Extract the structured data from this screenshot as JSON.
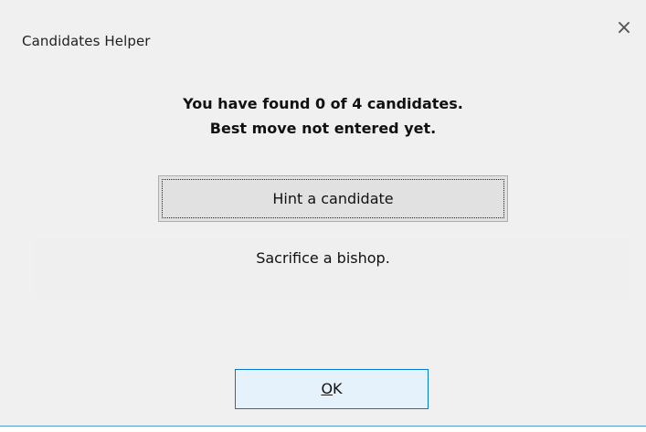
{
  "dialog": {
    "title": "Candidates Helper",
    "close_glyph": "×",
    "close_icon": "close-icon"
  },
  "status": {
    "found_line": "You have found 0 of 4 candidates.",
    "best_move_line": "Best move not entered yet."
  },
  "hint": {
    "button_label": "Hint a candidate",
    "text": "Sacrifice a bishop."
  },
  "ok": {
    "mnemonic": "O",
    "rest": "K"
  },
  "colors": {
    "dialog_background": "#f0f0f0",
    "button_background": "#e1e1e1",
    "default_button_background": "#e5f1fb",
    "accent_border": "#0078d7"
  }
}
